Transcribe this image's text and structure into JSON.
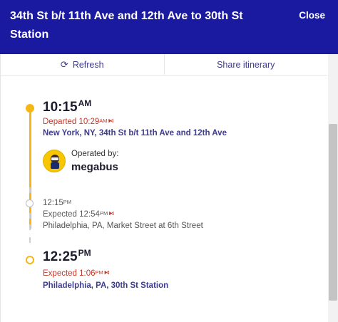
{
  "header": {
    "title": "34th St b/t 11th Ave and 12th Ave to 30th St Station",
    "close_label": "Close"
  },
  "actions": {
    "refresh_icon": "refresh-icon",
    "refresh_label": "Refresh",
    "share_label": "Share itinerary"
  },
  "stops": {
    "origin": {
      "time": "10:15",
      "ampm": "AM",
      "status_prefix": "Departed ",
      "status_time": "10:29",
      "status_ampm": "AM",
      "location": "New York, NY, 34th St b/t 11th Ave and 12th Ave"
    },
    "intermediate": {
      "time": "12:15",
      "ampm": "PM",
      "status_prefix": "Expected ",
      "status_time": "12:54",
      "status_ampm": "PM",
      "location": "Philadelphia, PA, Market Street at 6th Street"
    },
    "destination": {
      "time": "12:25",
      "ampm": "PM",
      "status_prefix": "Expected ",
      "status_time": "1:06",
      "status_ampm": "PM",
      "location": "Philadelphia, PA, 30th St Station"
    }
  },
  "operator": {
    "label": "Operated by:",
    "name": "megabus",
    "logo_icon": "megabus-mascot-icon"
  },
  "colors": {
    "header_bg": "#1a1aa0",
    "accent_yellow": "#f5b715",
    "status_red": "#c0392b",
    "link_purple": "#3e3c8c"
  }
}
